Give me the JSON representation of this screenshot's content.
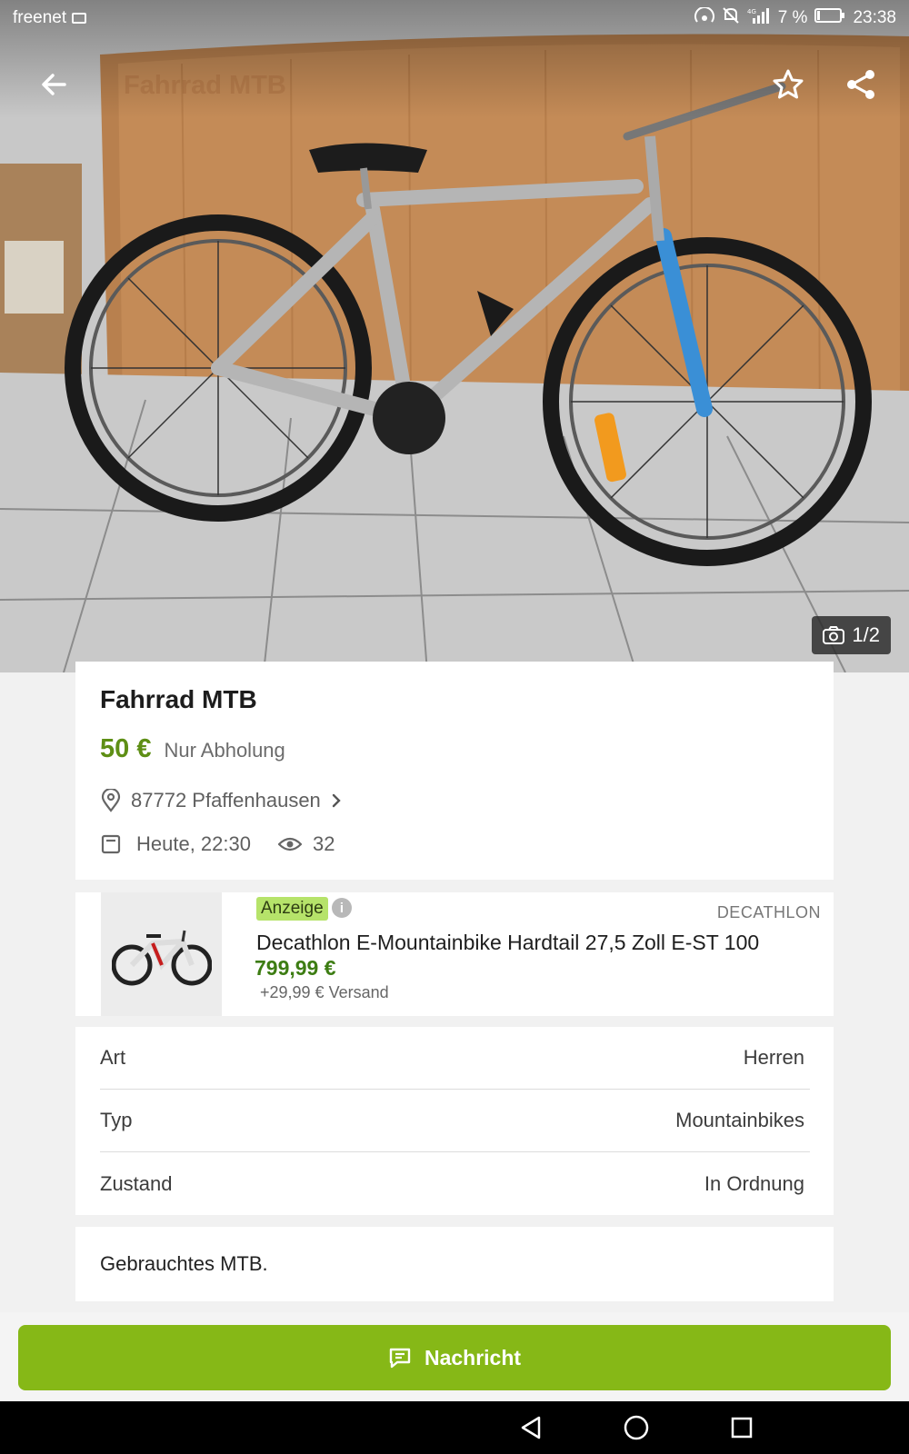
{
  "status_bar": {
    "carrier": "freenet",
    "battery": "7 %",
    "time": "23:38"
  },
  "gallery": {
    "counter": "1/2",
    "faded_title": "Fahrrad MTB"
  },
  "listing": {
    "title": "Fahrrad MTB",
    "price": "50 €",
    "shipping": "Nur Abholung",
    "location": "87772 Pfaffenhausen",
    "date": "Heute, 22:30",
    "views": "32"
  },
  "ad": {
    "badge": "Anzeige",
    "brand": "DECATHLON",
    "name": "Decathlon E-Mountainbike Hardtail 27,5 Zoll E-ST 100",
    "price": "799,99 €",
    "shipping": "+29,99 € Versand"
  },
  "attributes": [
    {
      "key": "Art",
      "value": "Herren"
    },
    {
      "key": "Typ",
      "value": "Mountainbikes"
    },
    {
      "key": "Zustand",
      "value": "In Ordnung"
    }
  ],
  "description": "Gebrauchtes MTB.",
  "actions": {
    "message_label": "Nachricht"
  },
  "icons": {
    "back": "arrow-left-icon",
    "favorite": "star-icon",
    "share": "share-icon",
    "camera": "camera-icon",
    "location": "location-pin-icon",
    "calendar": "calendar-icon",
    "views": "eye-icon",
    "message": "chat-icon"
  },
  "colors": {
    "accent": "#86b817",
    "price": "#5e8f15",
    "ad_badge": "#b6e36a"
  }
}
